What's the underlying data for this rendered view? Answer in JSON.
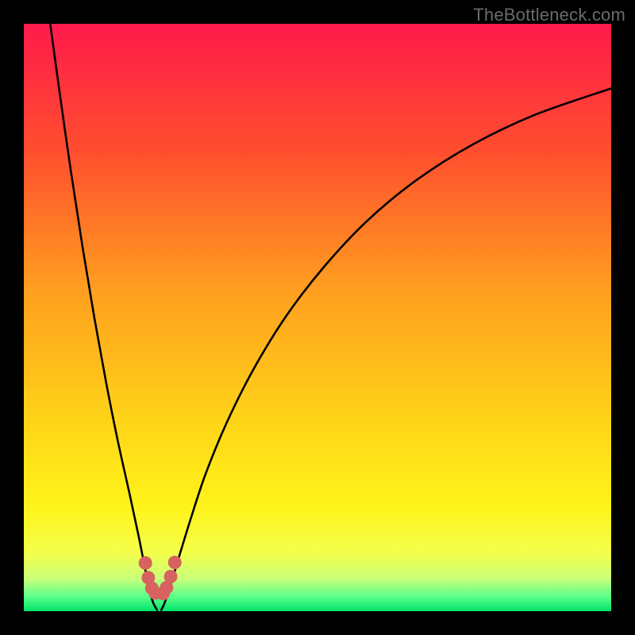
{
  "watermark": "TheBottleneck.com",
  "chart_data": {
    "type": "line",
    "title": "",
    "xlabel": "",
    "ylabel": "",
    "xlim": [
      0,
      100
    ],
    "ylim": [
      0,
      100
    ],
    "grid": false,
    "legend": false,
    "annotations": [],
    "background_gradient_stops": [
      {
        "pos": 0.0,
        "color": "#ff1a4b"
      },
      {
        "pos": 0.22,
        "color": "#ff4f2e"
      },
      {
        "pos": 0.45,
        "color": "#ff9e1f"
      },
      {
        "pos": 0.68,
        "color": "#ffd518"
      },
      {
        "pos": 0.82,
        "color": "#fff31a"
      },
      {
        "pos": 0.9,
        "color": "#f4ff4a"
      },
      {
        "pos": 0.945,
        "color": "#c9ff7a"
      },
      {
        "pos": 0.975,
        "color": "#5cff8a"
      },
      {
        "pos": 1.0,
        "color": "#00e36a"
      }
    ],
    "curve_left": [
      {
        "x": 4.5,
        "y": 100.0
      },
      {
        "x": 6.0,
        "y": 89.0
      },
      {
        "x": 8.0,
        "y": 75.0
      },
      {
        "x": 10.0,
        "y": 62.0
      },
      {
        "x": 12.0,
        "y": 50.0
      },
      {
        "x": 14.0,
        "y": 39.0
      },
      {
        "x": 16.0,
        "y": 29.0
      },
      {
        "x": 18.0,
        "y": 20.0
      },
      {
        "x": 19.5,
        "y": 13.0
      },
      {
        "x": 20.5,
        "y": 8.0
      },
      {
        "x": 21.3,
        "y": 4.0
      },
      {
        "x": 22.0,
        "y": 1.5
      },
      {
        "x": 22.7,
        "y": 0.2
      }
    ],
    "curve_right": [
      {
        "x": 23.4,
        "y": 0.2
      },
      {
        "x": 24.0,
        "y": 1.5
      },
      {
        "x": 25.0,
        "y": 4.5
      },
      {
        "x": 26.5,
        "y": 9.5
      },
      {
        "x": 28.5,
        "y": 16.0
      },
      {
        "x": 31.0,
        "y": 23.5
      },
      {
        "x": 34.5,
        "y": 32.0
      },
      {
        "x": 39.0,
        "y": 41.0
      },
      {
        "x": 44.5,
        "y": 50.0
      },
      {
        "x": 51.0,
        "y": 58.5
      },
      {
        "x": 58.5,
        "y": 66.5
      },
      {
        "x": 67.0,
        "y": 73.5
      },
      {
        "x": 76.5,
        "y": 79.5
      },
      {
        "x": 87.0,
        "y": 84.5
      },
      {
        "x": 100.0,
        "y": 89.0
      }
    ],
    "markers": [
      {
        "x": 20.7,
        "y": 8.2
      },
      {
        "x": 21.2,
        "y": 5.7
      },
      {
        "x": 21.8,
        "y": 3.9
      },
      {
        "x": 22.4,
        "y": 3.1
      },
      {
        "x": 23.7,
        "y": 3.0
      },
      {
        "x": 24.3,
        "y": 4.0
      },
      {
        "x": 25.0,
        "y": 5.9
      },
      {
        "x": 25.7,
        "y": 8.3
      }
    ],
    "marker_color": "#d8625f",
    "marker_radius_pct": 1.15
  }
}
